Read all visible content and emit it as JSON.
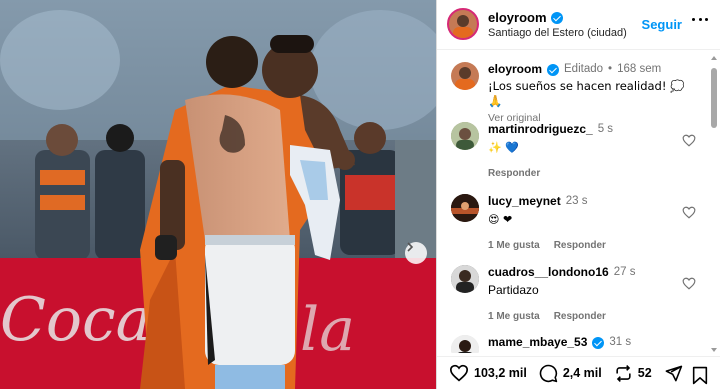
{
  "post": {
    "username": "eloyroom",
    "location": "Santiago del Estero (ciudad)",
    "follow_label": "Seguir",
    "caption": {
      "username": "eloyroom",
      "edited_label": "Editado",
      "separator": "•",
      "time": "168 sem",
      "text": "¡Los sueños se hacen realidad! 💭 🙏",
      "translate_label": "Ver original"
    }
  },
  "comments": [
    {
      "username": "martinrodriguezc_",
      "time": "5 s",
      "text": "✨ 💙",
      "likes_label": "",
      "reply_label": "Responder",
      "verified": false
    },
    {
      "username": "lucy_meynet",
      "time": "23 s",
      "text": "😍 ❤",
      "likes_label": "1 Me gusta",
      "reply_label": "Responder",
      "verified": false
    },
    {
      "username": "cuadros__londono16",
      "time": "27 s",
      "text": "Partidazo",
      "likes_label": "1 Me gusta",
      "reply_label": "Responder",
      "verified": false
    },
    {
      "username": "mame_mbaye_53",
      "time": "31 s",
      "text": "",
      "likes_label": "",
      "reply_label": "",
      "verified": true
    }
  ],
  "actions": {
    "likes": "103,2 mil",
    "comments": "2,4 mil",
    "reposts": "52"
  },
  "colors": {
    "accent": "#0095f6",
    "secondary_text": "#737373",
    "like_heart": "#ff3040"
  },
  "icons": [
    "verified-badge-icon",
    "more-options-icon",
    "heart-icon",
    "comment-icon",
    "repost-icon",
    "share-icon",
    "save-icon",
    "chevron-right-icon"
  ]
}
